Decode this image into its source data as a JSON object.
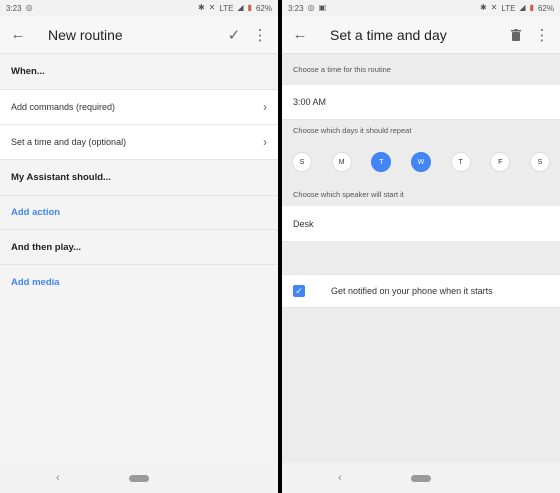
{
  "left": {
    "status": {
      "time": "3:23",
      "network": "LTE",
      "battery": "62%"
    },
    "appbar": {
      "title": "New routine"
    },
    "sections": {
      "when": "When...",
      "add_commands": "Add commands (required)",
      "set_time_day": "Set a time and day (optional)",
      "assistant_should": "My Assistant should...",
      "add_action": "Add action",
      "then_play": "And then play...",
      "add_media": "Add media"
    }
  },
  "right": {
    "status": {
      "time": "3:23",
      "network": "LTE",
      "battery": "62%"
    },
    "appbar": {
      "title": "Set a time and day"
    },
    "choose_time": "Choose a time for this routine",
    "time_value": "3:00 AM",
    "choose_days": "Choose which days it should repeat",
    "days": [
      {
        "label": "S",
        "selected": false
      },
      {
        "label": "M",
        "selected": false
      },
      {
        "label": "T",
        "selected": true
      },
      {
        "label": "W",
        "selected": true
      },
      {
        "label": "T",
        "selected": false
      },
      {
        "label": "F",
        "selected": false
      },
      {
        "label": "S",
        "selected": false
      }
    ],
    "choose_speaker": "Choose which speaker will start it",
    "speaker_value": "Desk",
    "notify_label": "Get notified on your phone when it starts",
    "notify_checked": true
  },
  "icons": {
    "back": "arrow-left",
    "check": "check",
    "more": "more-vert",
    "delete": "trash",
    "chevron": "chevron-right"
  },
  "colors": {
    "accent": "#4285f4"
  }
}
